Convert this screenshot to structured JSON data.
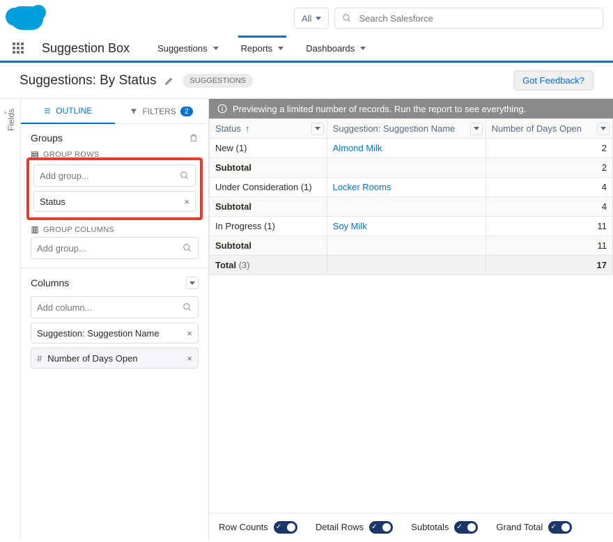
{
  "header": {
    "scope_label": "All",
    "search_placeholder": "Search Salesforce"
  },
  "nav": {
    "app_name": "Suggestion Box",
    "tabs": [
      {
        "label": "Suggestions"
      },
      {
        "label": "Reports"
      },
      {
        "label": "Dashboards"
      }
    ]
  },
  "title": {
    "text": "Suggestions: By Status",
    "pill": "SUGGESTIONS",
    "feedback": "Got Feedback?"
  },
  "fields_rail": "Fields",
  "side": {
    "outline_label": "OUTLINE",
    "filters_label": "FILTERS",
    "filters_count": "2",
    "groups_label": "Groups",
    "group_rows_label": "GROUP ROWS",
    "group_columns_label": "GROUP COLUMNS",
    "add_group_placeholder": "Add group...",
    "row_chip": "Status",
    "columns_label": "Columns",
    "add_column_placeholder": "Add column...",
    "col_chip1": "Suggestion: Suggestion Name",
    "col_chip2_prefix": "#",
    "col_chip2": "Number of Days Open"
  },
  "preview": {
    "banner": "Previewing a limited number of records. Run the report to see everything.",
    "headers": {
      "status": "Status",
      "name": "Suggestion: Suggestion Name",
      "days": "Number of Days Open"
    },
    "rows": [
      {
        "status": "New (1)",
        "name": "Almond Milk",
        "days": "2"
      },
      {
        "status": "Subtotal",
        "name": "",
        "days": "2",
        "sub": true
      },
      {
        "status": "Under Consideration (1)",
        "name": "Locker Rooms",
        "days": "4"
      },
      {
        "status": "Subtotal",
        "name": "",
        "days": "4",
        "sub": true
      },
      {
        "status": "In Progress (1)",
        "name": "Soy Milk",
        "days": "11"
      },
      {
        "status": "Subtotal",
        "name": "",
        "days": "11",
        "sub": true
      }
    ],
    "total_label": "Total",
    "total_count": "(3)",
    "total_days": "17",
    "toggles": {
      "row_counts": "Row Counts",
      "detail_rows": "Detail Rows",
      "subtotals": "Subtotals",
      "grand_total": "Grand Total"
    }
  }
}
